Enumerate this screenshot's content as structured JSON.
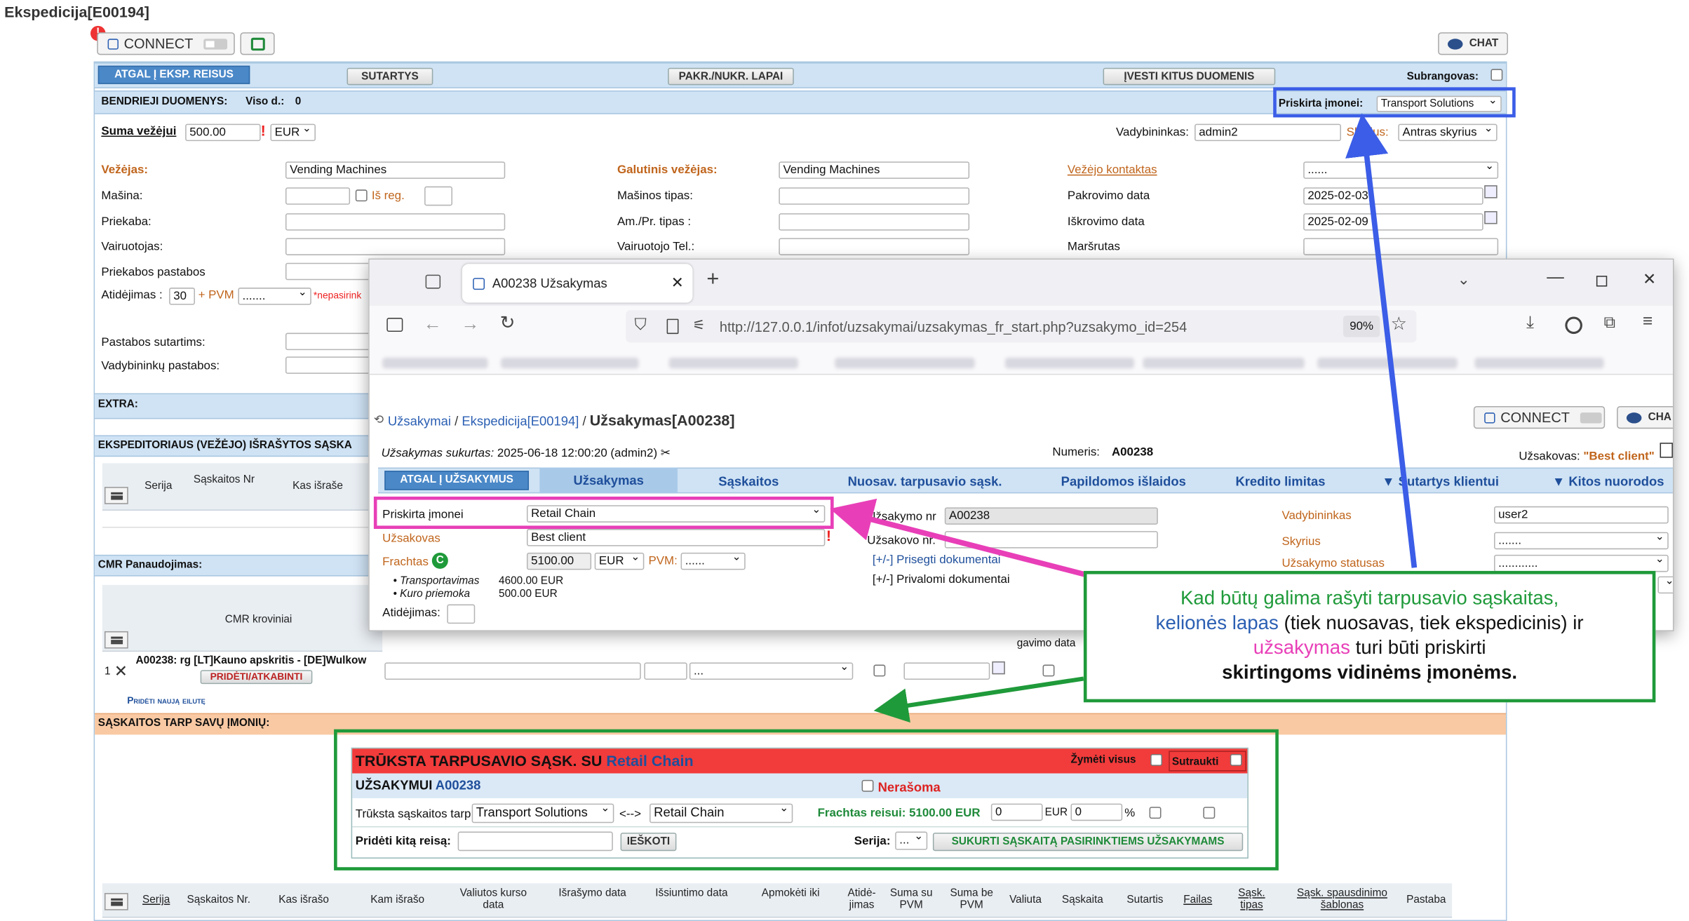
{
  "page": {
    "title": "Ekspedicija[E00194]"
  },
  "topbar": {
    "connect_label": "CONNECT",
    "chat_label": "CHAT",
    "badge": "!"
  },
  "nav": {
    "back": "ATGAL Į EKSP. REISUS",
    "sutartys": "SUTARTYS",
    "lapai": "PAKR./NUKR. LAPAI",
    "ivesti": "ĮVESTI KITUS DUOMENIS",
    "subrangovas": "Subrangovas:"
  },
  "general": {
    "header": "BENDRIEJI DUOMENYS:",
    "viso": "Viso d.:",
    "viso_value": "0",
    "priskirta_label": "Priskirta įmonei:",
    "priskirta_value": "Transport Solutions"
  },
  "row_suma": {
    "label": "Suma vežėjui",
    "value": "500.00",
    "currency": "EUR",
    "vadybininkas_label": "Vadybininkas:",
    "vadybininkas_value": "admin2",
    "skyrius_label": "Skyrius:",
    "skyrius_value": "Antras skyrius"
  },
  "form": {
    "vezejas_label": "Vežėjas:",
    "vezejas_value": "Vending Machines",
    "masina": "Mašina:",
    "is_reg": "Iš reg.",
    "priekaba": "Priekaba:",
    "vairuotojas": "Vairuotojas:",
    "priekabos_pastabos": "Priekabos pastabos",
    "atidejimas": "Atidėjimas :",
    "atidejimas_value": "30",
    "pvm": "+ PVM",
    "pvm_value": ".......",
    "nepasirinkta": "*nepasirink",
    "galutinis_label": "Galutinis vežėjas:",
    "galutinis_value": "Vending Machines",
    "masinos_tipas": "Mašinos tipas:",
    "am_pr": "Am./Pr. tipas :",
    "vairuotojo_tel": "Vairuotojo Tel.:",
    "kontaktas_label": "Vežėjo kontaktas",
    "kontaktas_value": "......",
    "pakrovimo": "Pakrovimo data",
    "pakrovimo_value": "2025-02-03",
    "iskrovimo": "Iškrovimo data",
    "iskrovimo_value": "2025-02-09",
    "marsrutas": "Maršrutas",
    "pastabos_sutartims": "Pastabos sutartims:",
    "vadybininku_pastabos": "Vadybininkų pastabos:"
  },
  "sections": {
    "extra": "EXTRA:",
    "eksp_saskaitos": "EKSPEDITORIAUS (VEŽĖJO) IŠRAŠYTOS SĄSKA",
    "cmr": "CMR Panaudojimas:",
    "tarp": "SĄSKAITOS TARP SAVŲ ĮMONIŲ:"
  },
  "eksp_table": {
    "headers": [
      "Serija",
      "Sąskaitos Nr",
      "Kas išraše"
    ]
  },
  "cmr_table": {
    "header": "CMR kroviniai",
    "row_no": "1",
    "row_text": "A00238: rg [LT]Kauno apskritis - [DE]Wulkow",
    "row_btn": "PRIDĖTI/ATKABINTI",
    "row_select": "...",
    "pogu_hint": "gavimo data",
    "add_row": "Pridėti naują eilutę"
  },
  "popup": {
    "tab_title": "A00238 Užsakymas",
    "url": "http://127.0.0.1/infot/uzsakymai/uzsakymas_fr_start.php?uzsakymo_id=254",
    "zoom": "90%",
    "breadcrumb_1": "Užsakymai",
    "breadcrumb_2": "Ekspedicija[E00194]",
    "breadcrumb_current": "Užsakymas[A00238]",
    "connect_label": "CONNECT",
    "chat_label": "CHA",
    "sukurtas_label": "Užsakymas sukurtas:",
    "sukurtas_value": "2025-06-18 12:00:20 (admin2)",
    "numeris_label": "Numeris:",
    "numeris_value": "A00238",
    "uzsakovas_label": "Užsakovas:",
    "uzsakovas_value": "\"Best client\"",
    "tabs": [
      "ATGAL Į UŽSAKYMUS",
      "Užsakymas",
      "Sąskaitos",
      "Nuosav. tarpusavio sąsk.",
      "Papildomos išlaidos",
      "Kredito limitas",
      "Sutartys klientui",
      "Kitos nuorodos"
    ],
    "priskirta_label": "Priskirta įmonei",
    "priskirta_value": "Retail Chain",
    "uzsakovas2_label": "Užsakovas",
    "uzsakovas2_value": "Best client",
    "frachtas_label": "Frachtas",
    "frachtas_value": "5100.00",
    "currency": "EUR",
    "pvm_label": "PVM:",
    "pvm_value": "......",
    "transport_label": "Transportavimas",
    "transport_value": "4600.00 EUR",
    "kuro_label": "Kuro priemoka",
    "kuro_value": "500.00 EUR",
    "atidejimas": "Atidėjimas:",
    "uzsakymo_nr_label": "Užsakymo nr",
    "uzsakymo_nr_value": "A00238",
    "uzsakovo_nr_label": "Užsakovo nr.",
    "prisegti": "[+/-] Prisegti dokumentai",
    "privalomi": "[+/-] Privalomi dokumentai",
    "vadybininkas_label": "Vadybininkas",
    "vadybininkas_value": "user2",
    "skyrius_label": "Skyrius",
    "skyrius_value": ".......",
    "statusas_label": "Užsakymo statusas",
    "statusas_value": "............"
  },
  "callout": {
    "line1": "Kad būtų galima rašyti tarpusavio sąskaitas,",
    "line2_blue": "kelionės lapas",
    "line2_rest": " (tiek nuosavas, tiek ekspedicinis) ir",
    "line3_pink": "užsakymas",
    "line3_rest": " turi būti priskirti",
    "line4": "skirtingoms vidinėms įmonėms."
  },
  "missing": {
    "title": "TRŪKSTA TARPUSAVIO SĄSK. SU",
    "title_company": "Retail Chain",
    "zymeti": "Žymėti visus",
    "sutraukti": "Sutraukti",
    "uzsakymui": "UŽSAKYMUI",
    "uzsakymui_nr": "A00238",
    "nerasoma": "Nerašoma",
    "truksta_label": "Trūksta sąskaitos tarp",
    "from": "Transport Solutions",
    "arrow": "<-->",
    "to": "Retail Chain",
    "frachtas": "Frachtas reisui: 5100.00 EUR",
    "val1": "0",
    "cur": "EUR",
    "val2": "0",
    "pct": "%",
    "prideti": "Pridėti kitą reisą:",
    "ieskoti": "IEŠKOTI",
    "serija": "Serija:",
    "serija_value": "...",
    "sukurti": "SUKURTI SĄSKAITĄ PASIRINKTIEMS UŽSAKYMAMS"
  },
  "bottom_table": {
    "headers": [
      "Serija",
      "Sąskaitos Nr.",
      "Kas išrašo",
      "Kam išrašo",
      "Valiutos kurso data",
      "Išrašymo data",
      "Išsiuntimo data",
      "Apmokėti iki",
      "Atidė-jimas",
      "Suma su PVM",
      "Suma be PVM",
      "Valiuta",
      "Sąskaita",
      "Sutartis",
      "Failas",
      "Sąsk. tipas",
      "Sąsk. spausdinimo šablonas",
      "Pastaba"
    ]
  },
  "colors": {
    "bar": "#cfe3f5",
    "accent_blue": "#2b5fb3",
    "pink": "#e83fb8",
    "green": "#1f9a3a",
    "blue_box": "#3b5de7",
    "red_header": "#f23b3b",
    "orange_bar": "#f9c9a3"
  }
}
